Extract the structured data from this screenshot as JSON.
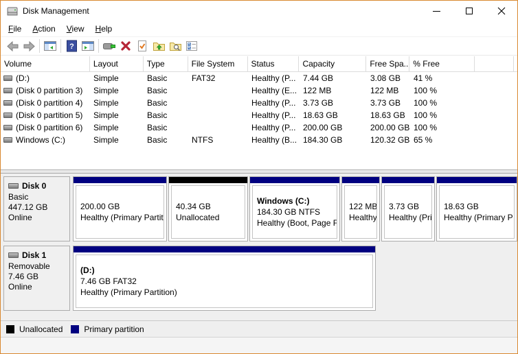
{
  "window": {
    "title": "Disk Management"
  },
  "menu": {
    "items": [
      {
        "label": "File"
      },
      {
        "label": "Action"
      },
      {
        "label": "View"
      },
      {
        "label": "Help"
      }
    ]
  },
  "toolbar": {
    "icons": [
      "back-arrow",
      "forward-arrow",
      "show-console-tree",
      "help",
      "show-action-pane",
      "device",
      "delete",
      "properties-check",
      "folder-up",
      "folder-search",
      "checklist"
    ]
  },
  "volume_table": {
    "columns": [
      "Volume",
      "Layout",
      "Type",
      "File System",
      "Status",
      "Capacity",
      "Free Spa...",
      "% Free"
    ],
    "rows": [
      {
        "volume": "(D:)",
        "layout": "Simple",
        "type": "Basic",
        "fs": "FAT32",
        "status": "Healthy (P...",
        "capacity": "7.44 GB",
        "free": "3.08 GB",
        "pct": "41 %"
      },
      {
        "volume": "(Disk 0 partition 3)",
        "layout": "Simple",
        "type": "Basic",
        "fs": "",
        "status": "Healthy (E...",
        "capacity": "122 MB",
        "free": "122 MB",
        "pct": "100 %"
      },
      {
        "volume": "(Disk 0 partition 4)",
        "layout": "Simple",
        "type": "Basic",
        "fs": "",
        "status": "Healthy (P...",
        "capacity": "3.73 GB",
        "free": "3.73 GB",
        "pct": "100 %"
      },
      {
        "volume": "(Disk 0 partition 5)",
        "layout": "Simple",
        "type": "Basic",
        "fs": "",
        "status": "Healthy (P...",
        "capacity": "18.63 GB",
        "free": "18.63 GB",
        "pct": "100 %"
      },
      {
        "volume": "(Disk 0 partition 6)",
        "layout": "Simple",
        "type": "Basic",
        "fs": "",
        "status": "Healthy (P...",
        "capacity": "200.00 GB",
        "free": "200.00 GB",
        "pct": "100 %"
      },
      {
        "volume": "Windows (C:)",
        "layout": "Simple",
        "type": "Basic",
        "fs": "NTFS",
        "status": "Healthy (B...",
        "capacity": "184.30 GB",
        "free": "120.32 GB",
        "pct": "65 %"
      }
    ]
  },
  "disks": [
    {
      "name": "Disk 0",
      "kind": "Basic",
      "size": "447.12 GB",
      "state": "Online",
      "partitions": [
        {
          "size_line": "200.00 GB",
          "status_line": "Healthy (Primary Partit",
          "color": "#000080"
        },
        {
          "size_line": "40.34 GB",
          "status_line": "Unallocated",
          "color": "#000000"
        },
        {
          "title": "Windows  (C:)",
          "size_line": "184.30 GB NTFS",
          "status_line": "Healthy (Boot, Page Fi",
          "color": "#000080"
        },
        {
          "size_line": "122 MB",
          "status_line": "Healthy (E",
          "color": "#000080"
        },
        {
          "size_line": "3.73 GB",
          "status_line": "Healthy (Prima",
          "color": "#000080"
        },
        {
          "size_line": "18.63 GB",
          "status_line": "Healthy (Primary P",
          "color": "#000080"
        }
      ]
    },
    {
      "name": "Disk 1",
      "kind": "Removable",
      "size": "7.46 GB",
      "state": "Online",
      "partitions": [
        {
          "title": "(D:)",
          "size_line": "7.46 GB FAT32",
          "status_line": "Healthy (Primary Partition)",
          "color": "#000080"
        }
      ]
    }
  ],
  "legend": {
    "items": [
      {
        "label": "Unallocated",
        "color": "#000000"
      },
      {
        "label": "Primary partition",
        "color": "#000080"
      }
    ]
  },
  "colors": {
    "window_border": "#d9882f",
    "primary_partition": "#000080",
    "unallocated": "#000000"
  }
}
